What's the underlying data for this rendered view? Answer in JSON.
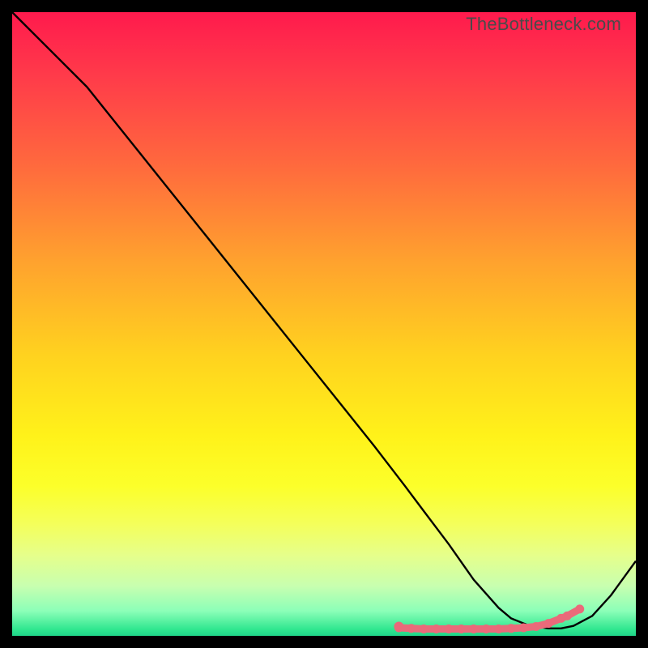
{
  "watermark": "TheBottleneck.com",
  "chart_data": {
    "type": "line",
    "title": "",
    "xlabel": "",
    "ylabel": "",
    "xlim": [
      0,
      100
    ],
    "ylim": [
      0,
      100
    ],
    "series": [
      {
        "name": "curve",
        "x": [
          0,
          6,
          12,
          20,
          30,
          40,
          50,
          58,
          63,
          66,
          70,
          74,
          78,
          80,
          83,
          86,
          88,
          90,
          93,
          96,
          100
        ],
        "y": [
          100,
          94,
          88,
          78,
          65.5,
          53,
          40.5,
          30.5,
          24,
          20,
          14.7,
          9,
          4.5,
          2.8,
          1.6,
          1.2,
          1.2,
          1.6,
          3.2,
          6.5,
          12
        ],
        "color": "#000000"
      },
      {
        "name": "markers",
        "x": [
          62,
          64,
          66,
          68,
          70,
          72,
          74,
          76,
          78,
          80,
          82,
          84,
          86,
          88,
          89,
          91
        ],
        "y": [
          1.3,
          1.2,
          1.1,
          1.1,
          1.1,
          1.1,
          1.1,
          1.1,
          1.1,
          1.2,
          1.3,
          1.5,
          2.0,
          2.8,
          3.2,
          4.3
        ],
        "color": "#ea6a7a"
      }
    ],
    "endpoint_cap": {
      "x": 62,
      "y": 1.5,
      "r": 6,
      "color": "#ea6a7a"
    }
  }
}
